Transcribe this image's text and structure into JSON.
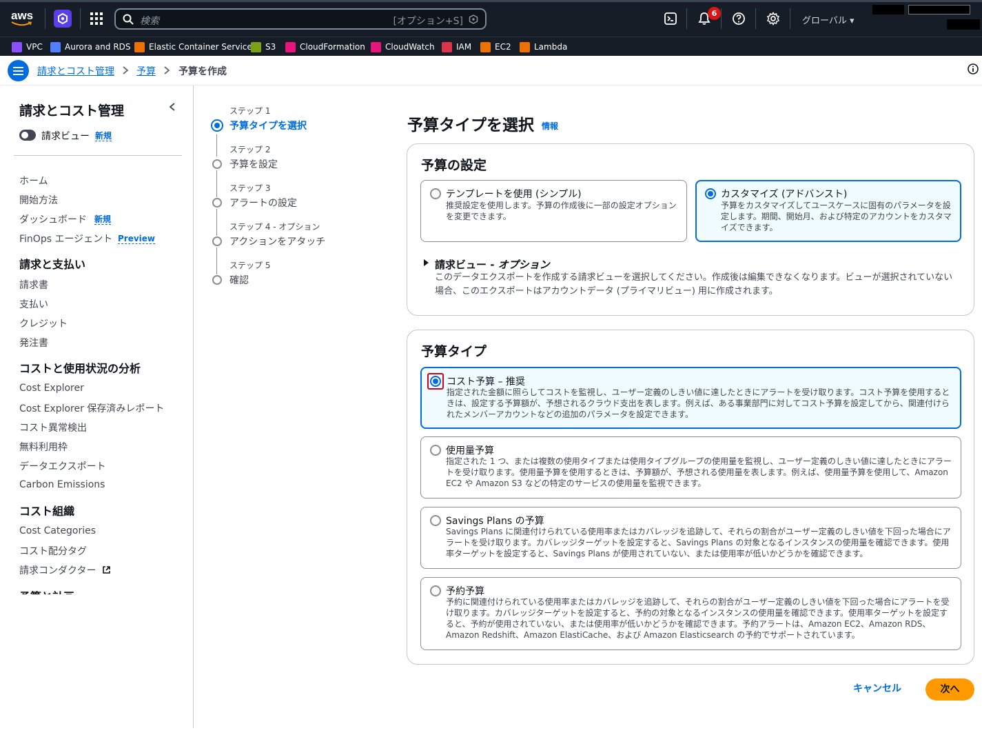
{
  "topbar": {
    "logo": "aws",
    "search_placeholder": "検索",
    "search_shortcut": "[オプション+S]",
    "notification_count": "6",
    "region": "グローバル"
  },
  "favorites": [
    {
      "label": "VPC",
      "color": "#8c4fff"
    },
    {
      "label": "Aurora and RDS",
      "color": "#527fff"
    },
    {
      "label": "Elastic Container Service",
      "color": "#ed7100"
    },
    {
      "label": "S3",
      "color": "#7aa116"
    },
    {
      "label": "CloudFormation",
      "color": "#e7157b"
    },
    {
      "label": "CloudWatch",
      "color": "#e7157b"
    },
    {
      "label": "IAM",
      "color": "#dd344c"
    },
    {
      "label": "EC2",
      "color": "#ed7100"
    },
    {
      "label": "Lambda",
      "color": "#ed7100"
    }
  ],
  "breadcrumb": {
    "items": [
      "請求とコスト管理",
      "予算",
      "予算を作成"
    ]
  },
  "sidebar": {
    "title": "請求とコスト管理",
    "toggle_label": "請求ビュー",
    "new_badge": "新規",
    "preview_badge": "Preview",
    "items_top": [
      "ホーム",
      "開始方法",
      "ダッシュボード",
      "FinOps エージェント"
    ],
    "section1": "請求と支払い",
    "items1": [
      "請求書",
      "支払い",
      "クレジット",
      "発注書"
    ],
    "section2": "コストと使用状況の分析",
    "items2": [
      "Cost Explorer",
      "Cost Explorer 保存済みレポート",
      "コスト異常検出",
      "無料利用枠",
      "データエクスポート",
      "Carbon Emissions"
    ],
    "section3": "コスト組織",
    "items3": [
      "Cost Categories",
      "コスト配分タグ",
      "請求コンダクター"
    ],
    "section4": "予算と計画"
  },
  "steps": [
    {
      "small": "ステップ 1",
      "label": "予算タイプを選択"
    },
    {
      "small": "ステップ 2",
      "label": "予算を設定"
    },
    {
      "small": "ステップ 3",
      "label": "アラートの設定"
    },
    {
      "small": "ステップ 4 - オプション",
      "label": "アクションをアタッチ"
    },
    {
      "small": "ステップ 5",
      "label": "確認"
    }
  ],
  "main": {
    "title": "予算タイプを選択",
    "info": "情報",
    "setup": {
      "title": "予算の設定",
      "template_title": "テンプレートを使用 (シンプル)",
      "template_desc": "推奨設定を使用します。予算の作成後に一部の設定オプションを変更できます。",
      "custom_title": "カスタマイズ (アドバンスト)",
      "custom_desc": "予算をカスタマイズしてユースケースに固有のパラメータを設定します。期間、開始月、および特定のアカウントをカスタマイズできます。",
      "expander_title": "請求ビュー - ",
      "expander_title_opt": "オプション",
      "expander_desc": "このデータエクスポートを作成する請求ビューを選択してください。作成後は編集できなくなります。ビューが選択されていない場合、このエクスポートはアカウントデータ (プライマリビュー) 用に作成されます。"
    },
    "types": {
      "title": "予算タイプ",
      "cost_title": "コスト予算 – 推奨",
      "cost_desc": "指定された金額に照らしてコストを監視し、ユーザー定義のしきい値に達したときにアラートを受け取ります。コスト予算を使用するときは、設定する予算額が、予想されるクラウド支出を表します。例えば、ある事業部門に対してコスト予算を設定してから、関連付けられたメンバーアカウントなどの追加のパラメータを設定できます。",
      "usage_title": "使用量予算",
      "usage_desc": "指定された 1 つ、または複数の使用タイプまたは使用タイプグループの使用量を監視し、ユーザー定義のしきい値に達したときにアラートを受け取ります。使用量予算を使用するときは、予算額が、予想される使用量を表します。例えば、使用量予算を使用して、Amazon EC2 や Amazon S3 などの特定のサービスの使用量を監視できます。",
      "sp_title": "Savings Plans の予算",
      "sp_desc": "Savings Plans に関連付けられている使用率またはカバレッジを追跡して、それらの割合がユーザー定義のしきい値を下回った場合にアラートを受け取ります。カバレッジターゲットを設定すると、Savings Plans の対象となるインスタンスの使用量を確認できます。使用率ターゲットを設定すると、Savings Plans が使用されていない、または使用率が低いかどうかを確認できます。",
      "ri_title": "予約予算",
      "ri_desc": "予約に関連付けられている使用率またはカバレッジを追跡して、それらの割合がユーザー定義のしきい値を下回った場合にアラートを受け取ります。カバレッジターゲットを設定すると、予約の対象となるインスタンスの使用量を確認できます。使用率ターゲットを設定すると、予約が使用されていない、または使用率が低いかどうかを確認できます。予約アラートは、Amazon EC2、Amazon RDS、Amazon Redshift、Amazon ElastiCache、および Amazon Elasticsearch の予約でサポートされています。"
    },
    "cancel": "キャンセル",
    "next": "次へ"
  }
}
